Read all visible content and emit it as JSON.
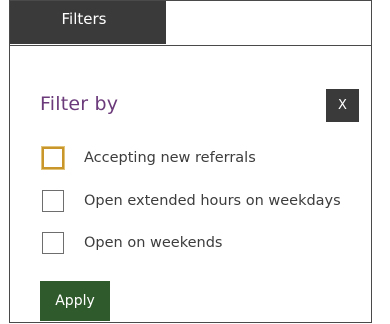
{
  "tabs": {
    "active_label": "Filters"
  },
  "panel": {
    "heading": "Filter by",
    "close_label": "X",
    "options": [
      {
        "label": "Accepting new referrals",
        "checked": false,
        "focused": true
      },
      {
        "label": "Open extended hours on weekdays",
        "checked": false,
        "focused": false
      },
      {
        "label": "Open on weekends",
        "checked": false,
        "focused": false
      }
    ],
    "apply_label": "Apply"
  },
  "colors": {
    "heading": "#6b3a7a",
    "dark": "#3a3a3a",
    "apply": "#2f5a2b",
    "focus": "#c8962a"
  }
}
